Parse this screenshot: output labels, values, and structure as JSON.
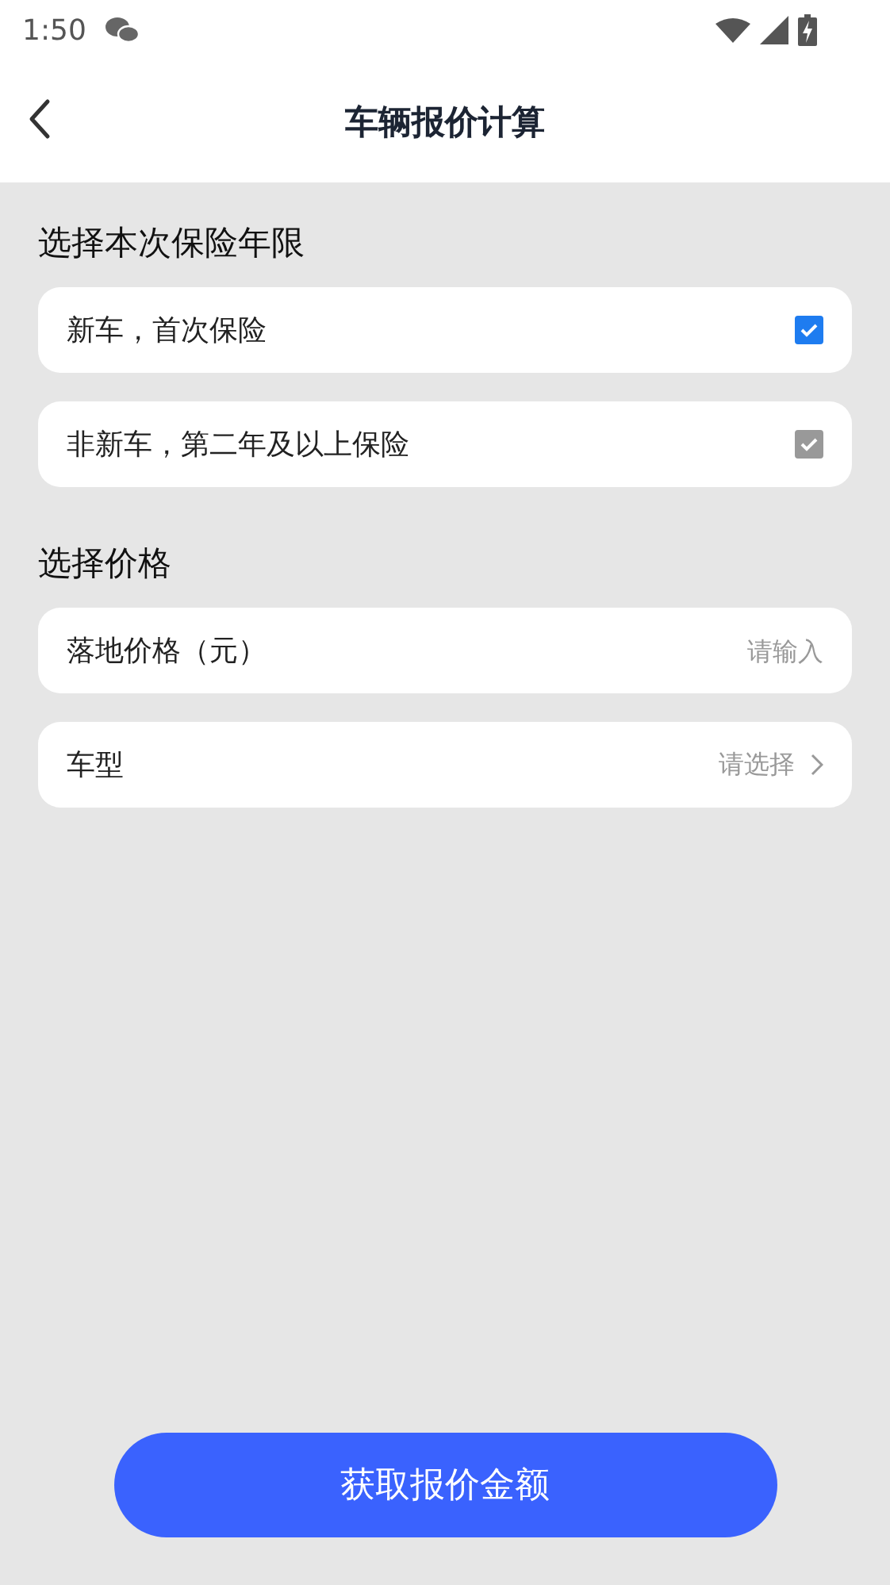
{
  "status_bar": {
    "time": "1:50"
  },
  "header": {
    "title": "车辆报价计算"
  },
  "sections": [
    {
      "title": "选择本次保险年限",
      "items": [
        {
          "kind": "option",
          "label": "新车，首次保险",
          "checked": true,
          "disabled": false
        },
        {
          "kind": "option",
          "label": "非新车，第二年及以上保险",
          "checked": true,
          "disabled": true
        }
      ]
    },
    {
      "title": "选择价格",
      "items": [
        {
          "kind": "input",
          "label": "落地价格（元）",
          "placeholder": "请输入"
        },
        {
          "kind": "select",
          "label": "车型",
          "placeholder": "请选择"
        }
      ]
    }
  ],
  "submit_button": "获取报价金额"
}
